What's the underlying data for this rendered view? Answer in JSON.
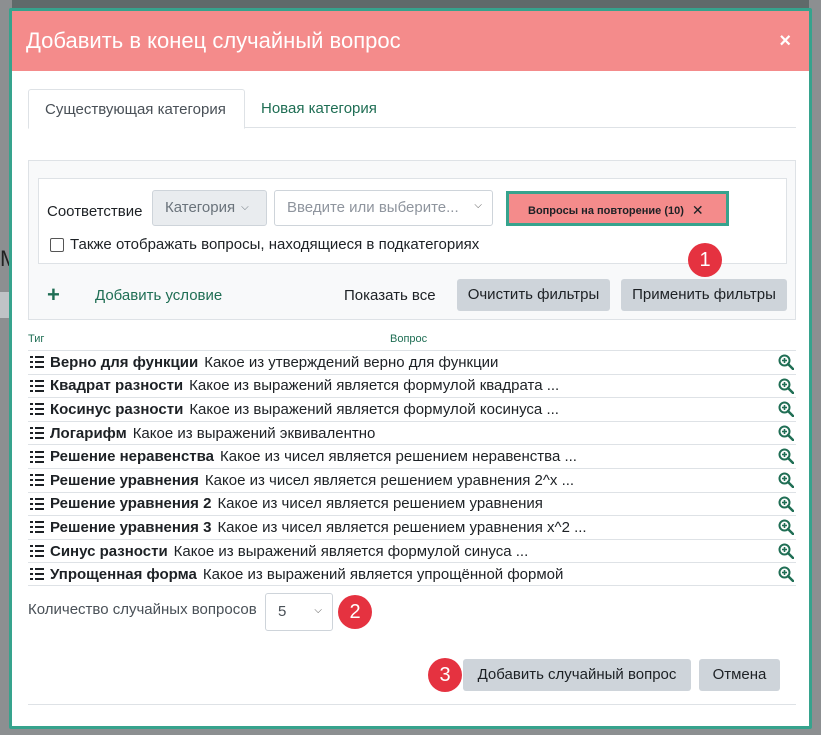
{
  "background": {
    "glyph": "М"
  },
  "modal": {
    "title": "Добавить в конец случайный вопрос",
    "close_label": "×",
    "tabs": [
      {
        "label": "Существующая категория",
        "active": true
      },
      {
        "label": "Новая категория",
        "active": false
      }
    ],
    "filters": {
      "match_label": "Соответствие",
      "category_select": "Категория",
      "search_placeholder": "Введите или выберите...",
      "selected_badge": "Вопросы на повторение (10)",
      "badge_remove": "✕",
      "subcategories_label": "Также отображать вопросы, находящиеся в подкатегориях",
      "subcategories_checked": false,
      "add_condition_icon": "+",
      "add_condition": "Добавить условие",
      "show_all": "Показать все",
      "clear_filters": "Очистить фильтры",
      "apply_filters": "Применить фильтры"
    },
    "table": {
      "col_tag": "Тиг",
      "col_question": "Вопрос",
      "rows": [
        {
          "name": "Верно для функции",
          "text": "Какое из утверждений верно для функции"
        },
        {
          "name": "Квадрат разности",
          "text": "Какое из выражений является формулой квадрата ..."
        },
        {
          "name": "Косинус разности",
          "text": "Какое из выражений является формулой косинуса ..."
        },
        {
          "name": "Логарифм",
          "text": "Какое из выражений эквивалентно"
        },
        {
          "name": "Решение неравенства",
          "text": "Какое из чисел является решением неравенства ..."
        },
        {
          "name": "Решение уравнения",
          "text": "Какое из чисел является решением уравнения 2^x ..."
        },
        {
          "name": "Решение уравнения 2",
          "text": "Какое из чисел является решением уравнения"
        },
        {
          "name": "Решение уравнения 3",
          "text": "Какое из чисел является решением уравнения x^2 ..."
        },
        {
          "name": "Синус разности",
          "text": "Какое из выражений является формулой синуса ..."
        },
        {
          "name": "Упрощенная форма",
          "text": "Какое из выражений является упрощённой формой"
        }
      ]
    },
    "count_label": "Количество случайных вопросов",
    "count_value": "5",
    "add_button": "Добавить случайный вопрос",
    "cancel_button": "Отмена",
    "markers": [
      "1",
      "2",
      "3"
    ]
  },
  "colors": {
    "header_bg": "#f48b8b",
    "accent_border": "#36a38d",
    "link_green": "#1f6e54",
    "marker_red": "#e53240"
  }
}
